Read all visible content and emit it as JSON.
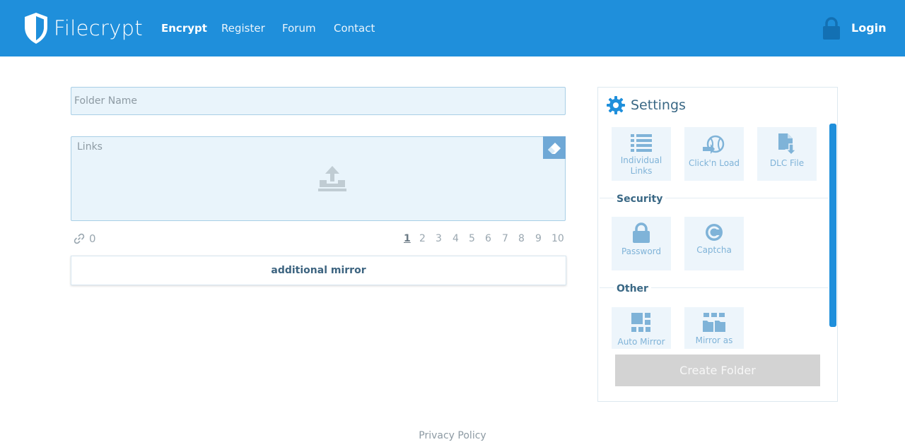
{
  "header": {
    "brand": "Filecrypt",
    "nav": [
      {
        "label": "Encrypt",
        "active": true
      },
      {
        "label": "Register",
        "active": false
      },
      {
        "label": "Forum",
        "active": false
      },
      {
        "label": "Contact",
        "active": false
      }
    ],
    "login_label": "Login"
  },
  "form": {
    "folder_placeholder": "Folder Name",
    "links_placeholder": "Links",
    "link_count": "0",
    "pages": [
      "1",
      "2",
      "3",
      "4",
      "5",
      "6",
      "7",
      "8",
      "9",
      "10"
    ],
    "active_page": "1",
    "mirror_button": "additional mirror"
  },
  "settings": {
    "title": "Settings",
    "tiles_top": [
      {
        "label": "Individual Links",
        "icon": "list-icon"
      },
      {
        "label": "Click'n Load",
        "icon": "click-n-load-icon"
      },
      {
        "label": "DLC File",
        "icon": "dlc-file-icon"
      }
    ],
    "security_label": "Security",
    "tiles_security": [
      {
        "label": "Password",
        "icon": "lock-icon"
      },
      {
        "label": "Captcha",
        "icon": "captcha-icon"
      }
    ],
    "other_label": "Other",
    "tiles_other": [
      {
        "label": "Auto Mirror",
        "icon": "auto-mirror-icon"
      },
      {
        "label": "Mirror as",
        "icon": "mirror-as-icon"
      }
    ],
    "create_button": "Create Folder"
  },
  "footer": {
    "privacy": "Privacy Policy"
  },
  "colors": {
    "brand_blue": "#1f8fdb",
    "tile_bg": "#edf5fb",
    "tile_icon": "#7fb3d8",
    "disabled_button": "#d3d3d3"
  }
}
